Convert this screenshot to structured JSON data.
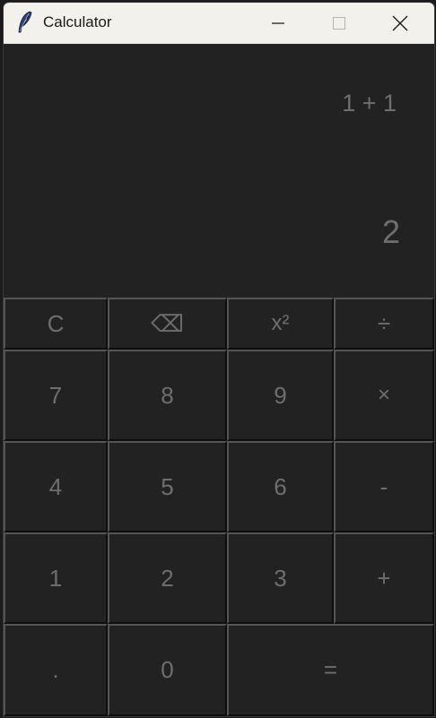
{
  "window": {
    "title": "Calculator",
    "controls": {
      "minimize": "minimize",
      "maximize": "maximize",
      "close": "close"
    }
  },
  "display": {
    "expression": "1 + 1",
    "result": "2"
  },
  "keypad": {
    "clear": "C",
    "backspace": "⌫",
    "square": "x²",
    "divide": "÷",
    "seven": "7",
    "eight": "8",
    "nine": "9",
    "multiply": "×",
    "four": "4",
    "five": "5",
    "six": "6",
    "subtract": "-",
    "one": "1",
    "two": "2",
    "three": "3",
    "add": "+",
    "decimal": ".",
    "zero": "0",
    "equals": "="
  },
  "colors": {
    "background": "#222222",
    "text": "#6e6e6e",
    "titlebar": "#f2f1eb"
  }
}
